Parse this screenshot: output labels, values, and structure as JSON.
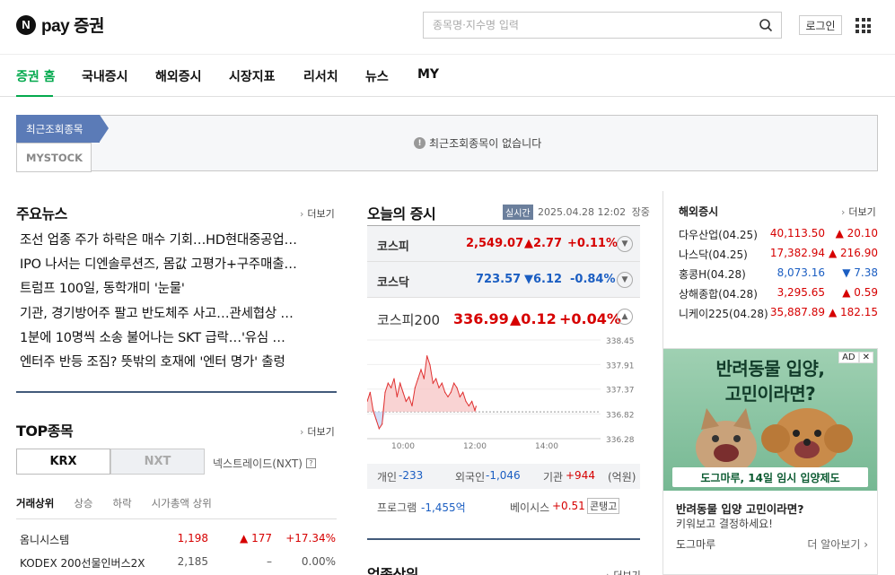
{
  "header": {
    "logo_text": "pay 증권",
    "logo_badge": "N",
    "search_placeholder": "종목명·지수명 입력",
    "login_label": "로그인"
  },
  "nav": {
    "items": [
      "증권 홈",
      "국내증시",
      "해외증시",
      "시장지표",
      "리서치",
      "뉴스",
      "MY"
    ]
  },
  "recent": {
    "tab_recent": "최근조회종목",
    "tab_mystock": "MYSTOCK",
    "empty_message": "최근조회종목이 없습니다"
  },
  "news": {
    "title": "주요뉴스",
    "more": "더보기",
    "items": [
      "조선 업종 주가 하락은 매수 기회…HD현대중공업…",
      "IPO 나서는 디엔솔루션즈, 몸값 고평가+구주매출…",
      "트럼프 100일, 동학개미 '눈물'",
      "기관, 경기방어주 팔고 반도체주 사고…관세협상 …",
      "1분에 10명씩 소송 불어나는 SKT 급락…'유심 …",
      "엔터주 반등 조짐? 뜻밖의 호재에 '엔터 명가' 출렁"
    ]
  },
  "top": {
    "title": "TOP종목",
    "more": "더보기",
    "toggle_on": "KRX",
    "toggle_off": "NXT",
    "nxt_label": "넥스트레이드(NXT)",
    "nxt_help": "?",
    "subtabs": [
      "거래상위",
      "상승",
      "하락",
      "시가총액 상위"
    ],
    "rows": [
      {
        "name": "옴니시스템",
        "price": "1,198",
        "change": "▲ 177",
        "pct": "+17.34%",
        "dir": "up"
      },
      {
        "name": "KODEX 200선물인버스2X",
        "price": "2,185",
        "change": "–",
        "pct": "0.00%",
        "dir": "flat"
      }
    ]
  },
  "market": {
    "title": "오늘의 증시",
    "live": "실시간",
    "time": "2025.04.28 12:02",
    "status": "장중",
    "indices": [
      {
        "name": "코스피",
        "value": "2,549.07",
        "change": "▲2.77",
        "pct": "+0.11%",
        "dir": "up"
      },
      {
        "name": "코스닥",
        "value": "723.57",
        "change": "▼6.12",
        "pct": "-0.84%",
        "dir": "down"
      }
    ],
    "kospi200": {
      "name": "코스피200",
      "value": "336.99",
      "change": "▲0.12",
      "pct": "+0.04%"
    },
    "investors": {
      "individual_label": "개인",
      "individual": "-233",
      "foreign_label": "외국인",
      "foreign": "-1,046",
      "institution_label": "기관",
      "institution": "+944",
      "unit": "(억원)"
    },
    "program": {
      "label": "프로그램",
      "value": "-1,455억",
      "basis_label": "베이시스",
      "basis": "+0.51",
      "basis_state": "콘탱고"
    },
    "next_section": "업종상위",
    "next_more": "더보기"
  },
  "chart_data": {
    "type": "line",
    "title": "",
    "x_ticks": [
      "10:00",
      "12:00",
      "14:00"
    ],
    "y_ticks": [
      "338.45",
      "337.91",
      "337.37",
      "336.82",
      "336.28"
    ],
    "ylim": [
      336.28,
      338.45
    ],
    "xlim": [
      "09:00",
      "15:30"
    ],
    "baseline": 336.87,
    "series": [
      {
        "x": [
          "09:00",
          "09:05",
          "09:10",
          "09:15",
          "09:20",
          "09:25",
          "09:30",
          "09:35",
          "09:40",
          "09:45",
          "09:50",
          "09:55",
          "10:00",
          "10:05",
          "10:10",
          "10:15",
          "10:20",
          "10:25",
          "10:30",
          "10:35",
          "10:40",
          "10:45",
          "10:50",
          "10:55",
          "11:00",
          "11:05",
          "11:10",
          "11:15",
          "11:20",
          "11:25",
          "11:30",
          "11:35",
          "11:40",
          "11:45",
          "11:50",
          "11:55",
          "12:00",
          "12:02"
        ],
        "values": [
          337.1,
          337.3,
          336.9,
          336.7,
          336.5,
          336.6,
          337.3,
          337.5,
          337.4,
          337.6,
          337.2,
          337.5,
          337.3,
          337.1,
          337.2,
          337.0,
          337.4,
          337.6,
          337.8,
          337.6,
          338.1,
          337.9,
          337.5,
          337.6,
          337.4,
          337.5,
          337.3,
          337.2,
          337.3,
          337.5,
          337.4,
          337.2,
          337.3,
          337.1,
          337.0,
          337.1,
          336.9,
          336.99
        ]
      }
    ]
  },
  "overseas": {
    "title": "해외증시",
    "more": "더보기",
    "rows": [
      {
        "name": "다우산업(04.25)",
        "value": "40,113.50",
        "change": "▲ 20.10",
        "dir": "up"
      },
      {
        "name": "나스닥(04.25)",
        "value": "17,382.94",
        "change": "▲ 216.90",
        "dir": "up"
      },
      {
        "name": "홍콩H(04.28)",
        "value": "8,073.16",
        "change": "▼ 7.38",
        "dir": "down"
      },
      {
        "name": "상해종합(04.28)",
        "value": "3,295.65",
        "change": "▲ 0.59",
        "dir": "up"
      },
      {
        "name": "니케이225(04.28)",
        "value": "35,887.89",
        "change": "▲ 182.15",
        "dir": "up"
      }
    ]
  },
  "ad": {
    "headline1": "반려동물 입양,",
    "headline2": "고민이라면?",
    "strip": "도그마루, 14일 임시 입양제도",
    "mark": "AD",
    "close": "✕",
    "title": "반려동물 입양 고민이라면?",
    "desc": "키워보고 결정하세요!",
    "brand": "도그마루",
    "cta": "더 알아보기 ›"
  },
  "colors": {
    "accent": "#03a94d",
    "up": "#d60000",
    "down": "#1b5ec2",
    "recent_tab": "#5b7bb7"
  }
}
